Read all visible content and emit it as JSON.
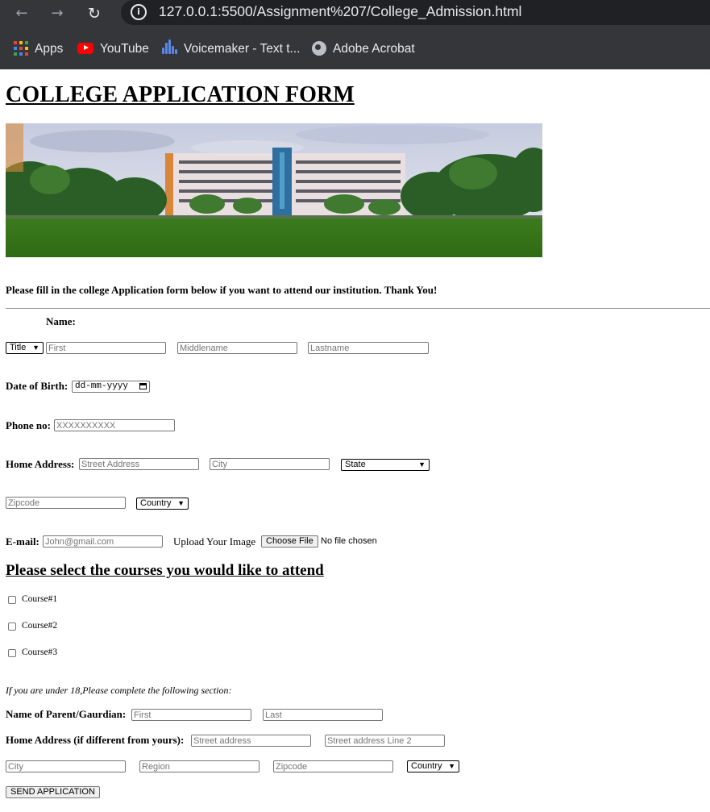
{
  "browser": {
    "url": "127.0.0.1:5500/Assignment%207/College_Admission.html",
    "bookmarks": [
      {
        "label": "Apps",
        "icon": "apps-grid-icon"
      },
      {
        "label": "YouTube",
        "icon": "youtube-icon"
      },
      {
        "label": "Voicemaker - Text t...",
        "icon": "voicemaker-icon"
      },
      {
        "label": "Adobe Acrobat",
        "icon": "globe-icon"
      }
    ]
  },
  "page": {
    "title": "COLLEGE APPLICATION FORM",
    "intro": "Please fill in the college Application form below if you want to attend our institution. Thank You!"
  },
  "form": {
    "name_label": "Name:",
    "title_select": "Title",
    "first_placeholder": "First",
    "middle_placeholder": "Middlename",
    "last_placeholder": "Lastname",
    "dob_label": "Date of Birth:",
    "dob_placeholder": "dd-mm-yyyy",
    "phone_label": "Phone no:",
    "phone_placeholder": "XXXXXXXXXX",
    "address_label": "Home Address:",
    "street_placeholder": "Street Address",
    "city_placeholder": "City",
    "state_select": "State",
    "zip_placeholder": "Zipcode",
    "country_select": "Country",
    "email_label": "E-mail:",
    "email_placeholder": "John@gmail.com",
    "upload_label": "Upload Your Image",
    "choose_file": "Choose File",
    "no_file": "No file chosen"
  },
  "courses": {
    "heading": "Please select the courses you would like to attend",
    "items": [
      "Course#1",
      "Course#2",
      "Course#3"
    ]
  },
  "guardian": {
    "note": "If you are under 18,Please complete the following section:",
    "parent_label": "Name of Parent/Gaurdian:",
    "parent_first_placeholder": "First",
    "parent_last_placeholder": "Last",
    "address_label": "Home Address (if different from yours):",
    "street_placeholder": "Street address",
    "street2_placeholder": "Street address Line 2",
    "city_placeholder": "City",
    "region_placeholder": "Region",
    "zip_placeholder": "Zipcode",
    "country_select": "Country"
  },
  "submit_label": "SEND APPLICATION"
}
